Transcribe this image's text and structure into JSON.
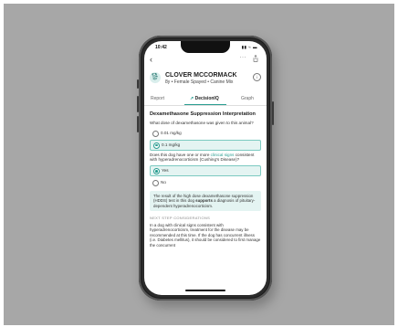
{
  "status": {
    "time": "10:42",
    "icons": "▮▮ ≈ ▬"
  },
  "nav": {
    "back": "‹",
    "more": "···"
  },
  "patient": {
    "name": "CLOVER MCCORMACK",
    "details": "8y • Female Spayed • Canine Mix",
    "info_label": "i"
  },
  "tabs": [
    {
      "label": "Report"
    },
    {
      "label": "DecisionIQ"
    },
    {
      "label": "Graph"
    }
  ],
  "content": {
    "title": "Dexamethasone Suppression Interpretation",
    "q1": "What dose of dexamethasone was given to this animal?",
    "q1_options": [
      {
        "label": "0.01 mg/kg",
        "selected": false
      },
      {
        "label": "0.1 mg/kg",
        "selected": true
      }
    ],
    "q2_prefix": "Does this dog have one or more",
    "q2_link": "clinical signs",
    "q2_suffix": "consistent with hyperadrenocorticism (Cushing's Disease)?",
    "q2_options": [
      {
        "label": "Yes",
        "selected": true
      },
      {
        "label": "No",
        "selected": false
      }
    ],
    "result_pre": "The result of the high dose dexamethasone suppression (HDDS) test in this dog",
    "result_bold": "supports",
    "result_post": "a diagnosis of pituitary-dependent hyperadrenocorticism.",
    "section_label": "NEXT STEP CONSIDERATIONS",
    "body": "In a dog with clinical signs consistent with hyperadrenocorticism, treatment for the disease may be recommended at this time. If the dog has concurrent illness (i.e. Diabetes mellitus), it should be considered to first manage the concurrent"
  },
  "colors": {
    "accent": "#2a9d91",
    "highlight": "#e4f4f2",
    "background": "#a7a7a7"
  }
}
